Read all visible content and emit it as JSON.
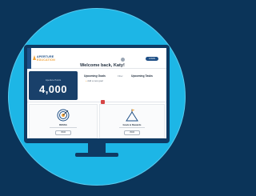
{
  "app": {
    "logo_line1": "APERTURE",
    "logo_line2": "EDUCATION",
    "welcome": "Welcome back, Katy!",
    "login_label": "LOGIN"
  },
  "dashboard": {
    "points_label": "Aperture Points",
    "points_value": "4,000",
    "goals_title": "Upcoming Goals",
    "add_goal": "Add a new goal",
    "filter_label": "Filter",
    "tasks_title": "Upcoming Tasks"
  },
  "cards": [
    {
      "label": "DESSA",
      "button": "VIEW",
      "icon": "target-icon"
    },
    {
      "label": "Goals & Rewards",
      "button": "VIEW",
      "icon": "mountain-flag-icon"
    }
  ],
  "colors": {
    "background": "#0b3459",
    "circle": "#1db6e6",
    "monitor": "#0e3a63",
    "brand": "#1e4f86",
    "accent": "#f1a33b"
  }
}
